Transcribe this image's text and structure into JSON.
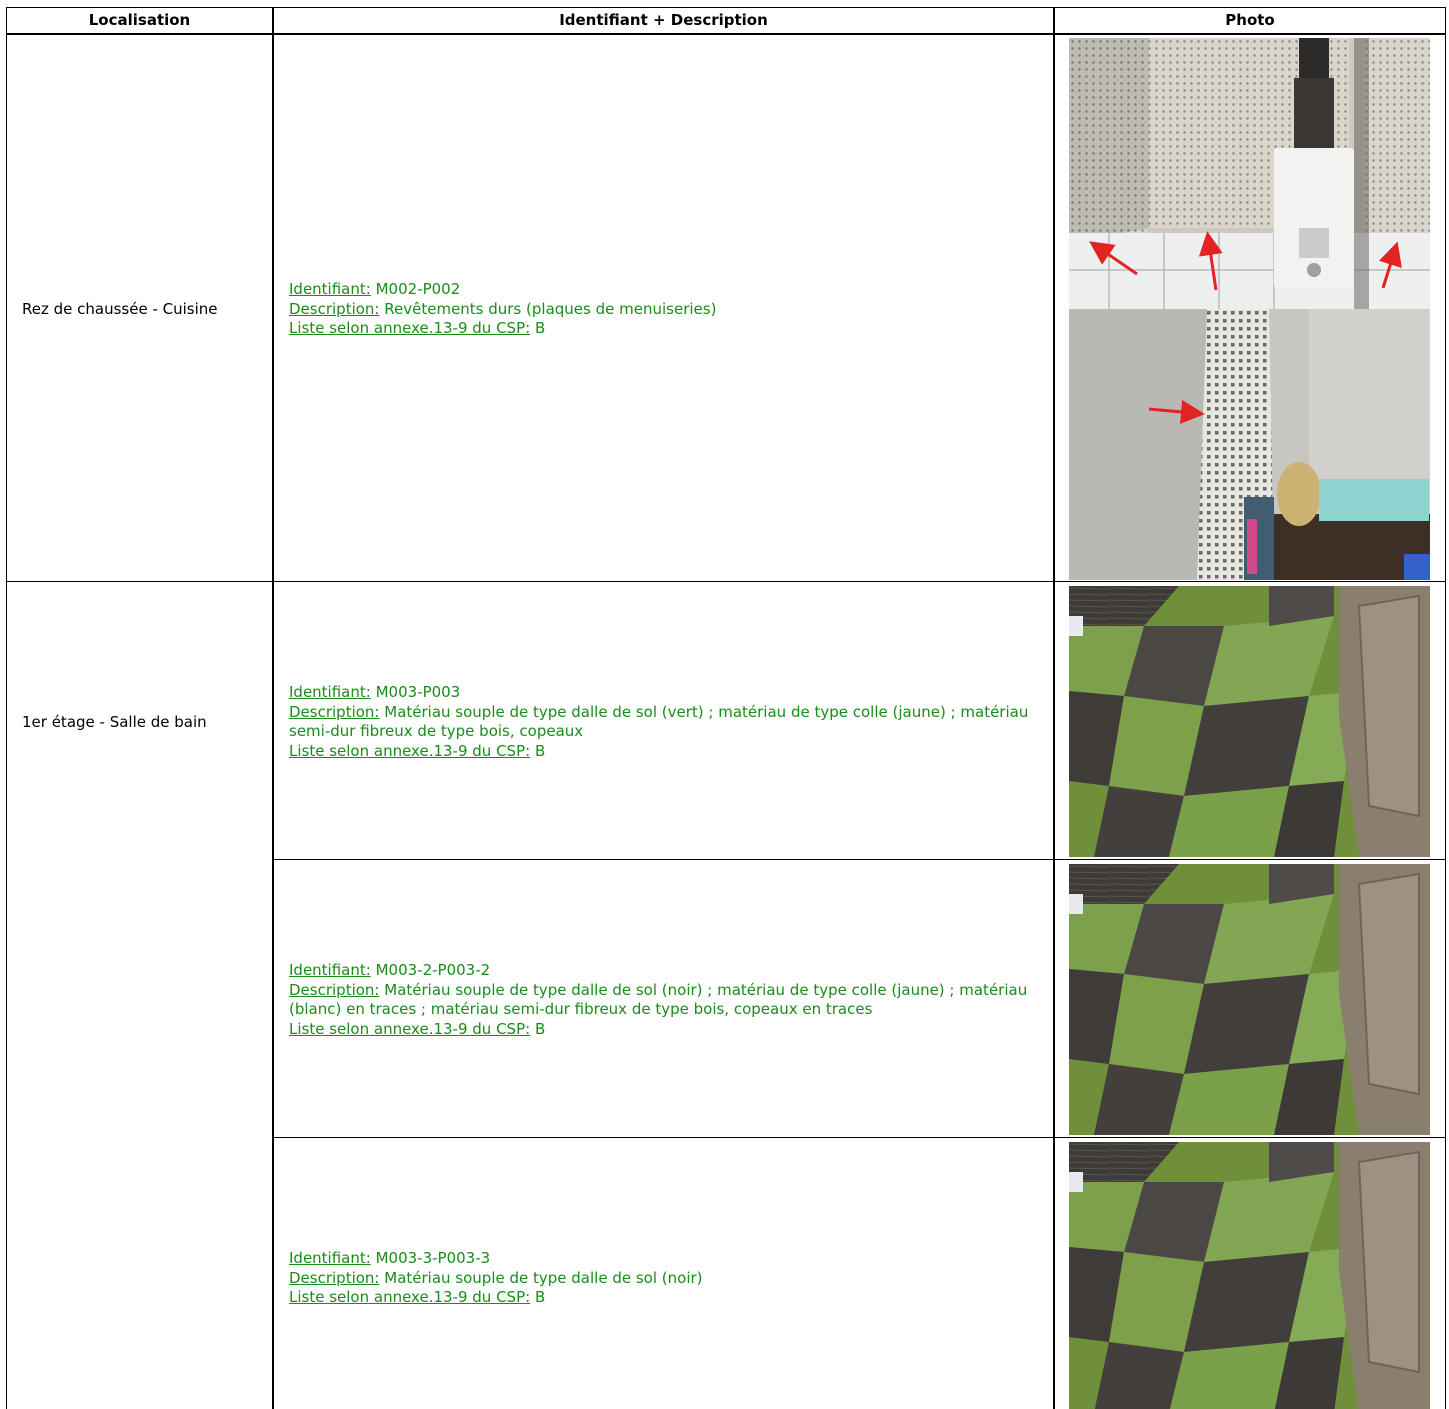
{
  "table": {
    "headers": {
      "localisation": "Localisation",
      "identifiant": "Identifiant + Description",
      "photo": "Photo"
    },
    "labels": {
      "identifiant": "Identifiant:",
      "description": "Description:",
      "liste": "Liste selon annexe.13-9 du CSP:"
    },
    "groups": [
      {
        "location": "Rez de chaussée - Cuisine"
      },
      {
        "location": "1er étage - Salle de bain"
      }
    ],
    "rows": [
      {
        "id": "M002-P002",
        "description": "Revêtements durs (plaques de menuiseries)",
        "liste": "B",
        "photo_icons": [
          "kitchen-water-heater-photo-icon",
          "kitchen-panel-photo-icon"
        ]
      },
      {
        "id": "M003-P003",
        "description": "Matériau souple de type dalle de sol (vert) ; matériau de type colle (jaune) ; matériau semi-dur fibreux de type bois, copeaux",
        "liste": "B",
        "photo_icons": [
          "floor-tiles-photo-icon"
        ]
      },
      {
        "id": "M003-2-P003-2",
        "description": "Matériau souple de type dalle de sol (noir) ; matériau de type colle (jaune) ; matériau (blanc) en traces ; matériau semi-dur fibreux de type bois, copeaux en traces",
        "liste": "B",
        "photo_icons": [
          "floor-tiles-photo-icon"
        ]
      },
      {
        "id": "M003-3-P003-3",
        "description": "Matériau souple de type dalle de sol (noir)",
        "liste": "B",
        "photo_icons": [
          "floor-tiles-photo-icon"
        ]
      }
    ]
  },
  "colors": {
    "text_green": "#1a8c1a",
    "border": "#000000",
    "arrow_red": "#e32222"
  }
}
